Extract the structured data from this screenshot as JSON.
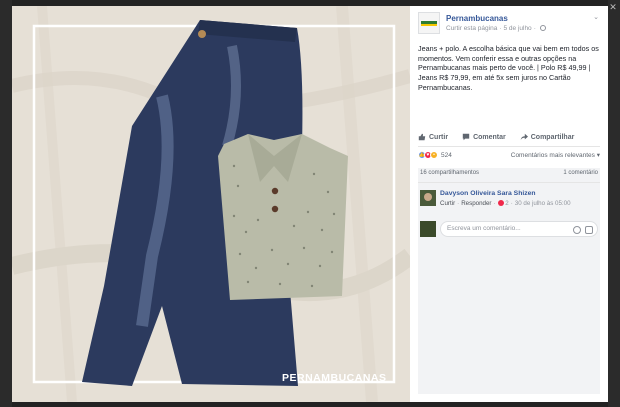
{
  "photo": {
    "watermark": "PERNAMBUCANAS",
    "alt_subject": "denim-jeans-and-polo-shirt"
  },
  "post": {
    "page_name": "Pernambucanas",
    "meta": {
      "action": "Curtir esta página",
      "date": "5 de julho"
    },
    "text": "Jeans + polo. A escolha básica que vai bem em todos os momentos. Vem conferir essa e outras opções na Pernambucanas mais perto de você. | Polo R$ 49,99 | Jeans R$ 79,99, em até 5x sem juros no Cartão Pernambucanas.",
    "actions": {
      "like": "Curtir",
      "comment": "Comentar",
      "share": "Compartilhar"
    },
    "reactions": {
      "count": "524",
      "filter": "Comentários mais relevantes ▾"
    },
    "shares": {
      "label": "16 compartilhamentos",
      "comments": "1 comentário"
    },
    "comment": {
      "author": "Davyson Oliveira Sara Shizen",
      "like": "Curtir",
      "reply": "Responder",
      "likes": "2",
      "date": "30 de julho às 05:00"
    },
    "write_placeholder": "Escreva um comentário..."
  },
  "colors": {
    "link": "#365899",
    "secondary": "#90949c",
    "like_blue": "#5890ff",
    "love_red": "#f0284a",
    "wow_yellow": "#f7b125"
  },
  "icons": {
    "like": "thumbs-up-icon",
    "comment": "speech-bubble-icon",
    "share": "share-arrow-icon",
    "privacy": "globe-icon",
    "options": "chevron-down-icon",
    "close": "close-icon",
    "camera": "camera-icon",
    "sticker": "sticker-icon"
  }
}
